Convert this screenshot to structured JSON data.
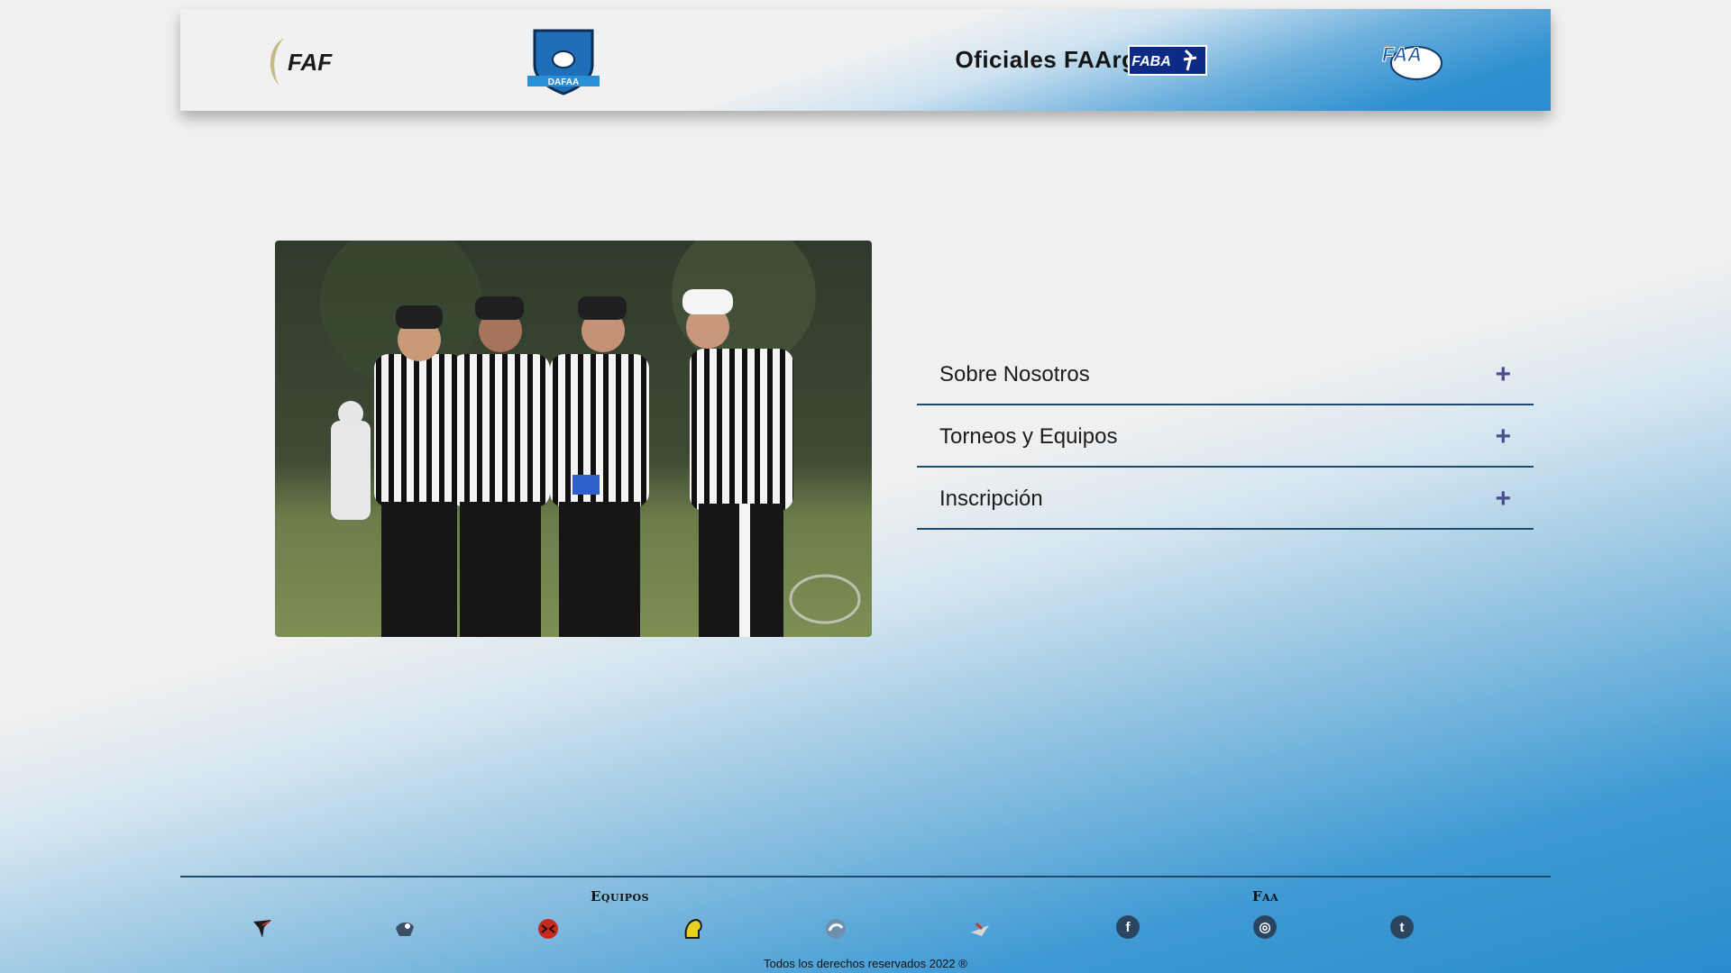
{
  "header": {
    "title": "Oficiales FAArg",
    "logos": [
      {
        "name": "faf-logo",
        "text": "FAF"
      },
      {
        "name": "dafaa-shield-logo",
        "text": "DAFAA"
      },
      {
        "name": "faba-logo",
        "text": "FABA"
      },
      {
        "name": "faa-argentina-logo",
        "text": "FAA"
      }
    ]
  },
  "main": {
    "photo_icon": "referees-photo",
    "accordion": [
      {
        "label": "Sobre Nosotros",
        "icon": "plus-icon"
      },
      {
        "label": "Torneos y Equipos",
        "icon": "plus-icon"
      },
      {
        "label": "Inscripción",
        "icon": "plus-icon"
      }
    ]
  },
  "footer": {
    "teams_heading": "Equipos",
    "faa_heading": "Faa",
    "team_icons": [
      "team-logo-1-icon",
      "team-logo-2-icon",
      "team-logo-3-icon",
      "team-logo-4-icon",
      "team-logo-5-icon",
      "team-logo-6-icon"
    ],
    "social": [
      {
        "icon": "facebook-icon",
        "glyph": "f"
      },
      {
        "icon": "instagram-icon",
        "glyph": "◎"
      },
      {
        "icon": "twitter-icon",
        "glyph": "t"
      }
    ],
    "copyright": "Todos los derechos reservados 2022 ®"
  },
  "colors": {
    "accent": "#2a8bcd",
    "divider": "#1e4a6e",
    "plus": "#4b4f8f"
  }
}
